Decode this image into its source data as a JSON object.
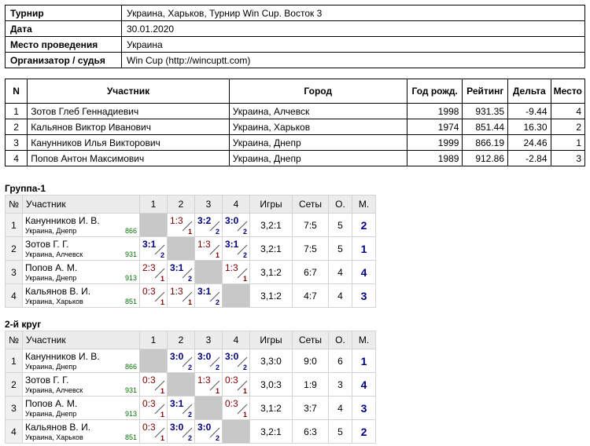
{
  "info": [
    {
      "label": "Турнир",
      "value": "Украина, Харьков, Турнир Win Cup. Восток 3"
    },
    {
      "label": "Дата",
      "value": "30.01.2020"
    },
    {
      "label": "Место проведения",
      "value": "Украина"
    },
    {
      "label": "Организатор / судья",
      "value": "Win Cup (http://wincuptt.com)"
    }
  ],
  "participants": {
    "headers": [
      "N",
      "Участник",
      "Город",
      "Год рожд.",
      "Рейтинг",
      "Дельта",
      "Место"
    ],
    "rows": [
      [
        "1",
        "Зотов Глеб Геннадиевич",
        "Украина, Алчевск",
        "1998",
        "931.35",
        "-9.44",
        "4"
      ],
      [
        "2",
        "Кальянов Виктор Иванович",
        "Украина, Харьков",
        "1974",
        "851.44",
        "16.30",
        "2"
      ],
      [
        "3",
        "Канунников Илья Викторович",
        "Украина, Днепр",
        "1999",
        "866.19",
        "24.46",
        "1"
      ],
      [
        "4",
        "Попов Антон Максимович",
        "Украина, Днепр",
        "1989",
        "912.86",
        "-2.84",
        "3"
      ]
    ]
  },
  "groups": [
    {
      "title": "Группа-1",
      "headers": [
        "№",
        "Участник",
        "1",
        "2",
        "3",
        "4",
        "Игры",
        "Сеты",
        "О.",
        "М."
      ],
      "rows": [
        {
          "no": "1",
          "name": "Канунников И. В.",
          "city": "Украина, Днепр",
          "rating": "866",
          "cells": [
            null,
            {
              "score": "1:3",
              "pts": "1",
              "win": false
            },
            {
              "score": "3:2",
              "pts": "2",
              "win": true
            },
            {
              "score": "3:0",
              "pts": "2",
              "win": true
            }
          ],
          "games": "3,2:1",
          "sets": "7:5",
          "points": "5",
          "place": "2"
        },
        {
          "no": "2",
          "name": "Зотов Г. Г.",
          "city": "Украина, Алчевск",
          "rating": "931",
          "cells": [
            {
              "score": "3:1",
              "pts": "2",
              "win": true
            },
            null,
            {
              "score": "1:3",
              "pts": "1",
              "win": false
            },
            {
              "score": "3:1",
              "pts": "2",
              "win": true
            }
          ],
          "games": "3,2:1",
          "sets": "7:5",
          "points": "5",
          "place": "1"
        },
        {
          "no": "3",
          "name": "Попов А. М.",
          "city": "Украина, Днепр",
          "rating": "913",
          "cells": [
            {
              "score": "2:3",
              "pts": "1",
              "win": false
            },
            {
              "score": "3:1",
              "pts": "2",
              "win": true
            },
            null,
            {
              "score": "1:3",
              "pts": "1",
              "win": false
            }
          ],
          "games": "3,1:2",
          "sets": "6:7",
          "points": "4",
          "place": "4"
        },
        {
          "no": "4",
          "name": "Кальянов В. И.",
          "city": "Украина, Харьков",
          "rating": "851",
          "cells": [
            {
              "score": "0:3",
              "pts": "1",
              "win": false
            },
            {
              "score": "1:3",
              "pts": "1",
              "win": false
            },
            {
              "score": "3:1",
              "pts": "2",
              "win": true
            },
            null
          ],
          "games": "3,1:2",
          "sets": "4:7",
          "points": "4",
          "place": "3"
        }
      ]
    },
    {
      "title": "2-й круг",
      "headers": [
        "№",
        "Участник",
        "1",
        "2",
        "3",
        "4",
        "Игры",
        "Сеты",
        "О.",
        "М."
      ],
      "rows": [
        {
          "no": "1",
          "name": "Канунников И. В.",
          "city": "Украина, Днепр",
          "rating": "866",
          "cells": [
            null,
            {
              "score": "3:0",
              "pts": "2",
              "win": true
            },
            {
              "score": "3:0",
              "pts": "2",
              "win": true
            },
            {
              "score": "3:0",
              "pts": "2",
              "win": true
            }
          ],
          "games": "3,3:0",
          "sets": "9:0",
          "points": "6",
          "place": "1"
        },
        {
          "no": "2",
          "name": "Зотов Г. Г.",
          "city": "Украина, Алчевск",
          "rating": "931",
          "cells": [
            {
              "score": "0:3",
              "pts": "1",
              "win": false
            },
            null,
            {
              "score": "1:3",
              "pts": "1",
              "win": false
            },
            {
              "score": "0:3",
              "pts": "1",
              "win": false
            }
          ],
          "games": "3,0:3",
          "sets": "1:9",
          "points": "3",
          "place": "4"
        },
        {
          "no": "3",
          "name": "Попов А. М.",
          "city": "Украина, Днепр",
          "rating": "913",
          "cells": [
            {
              "score": "0:3",
              "pts": "1",
              "win": false
            },
            {
              "score": "3:1",
              "pts": "2",
              "win": true
            },
            null,
            {
              "score": "0:3",
              "pts": "1",
              "win": false
            }
          ],
          "games": "3,1:2",
          "sets": "3:7",
          "points": "4",
          "place": "3"
        },
        {
          "no": "4",
          "name": "Кальянов В. И.",
          "city": "Украина, Харьков",
          "rating": "851",
          "cells": [
            {
              "score": "0:3",
              "pts": "1",
              "win": false
            },
            {
              "score": "3:0",
              "pts": "2",
              "win": true
            },
            {
              "score": "3:0",
              "pts": "2",
              "win": true
            },
            null
          ],
          "games": "3,2:1",
          "sets": "6:3",
          "points": "5",
          "place": "2"
        }
      ]
    }
  ]
}
